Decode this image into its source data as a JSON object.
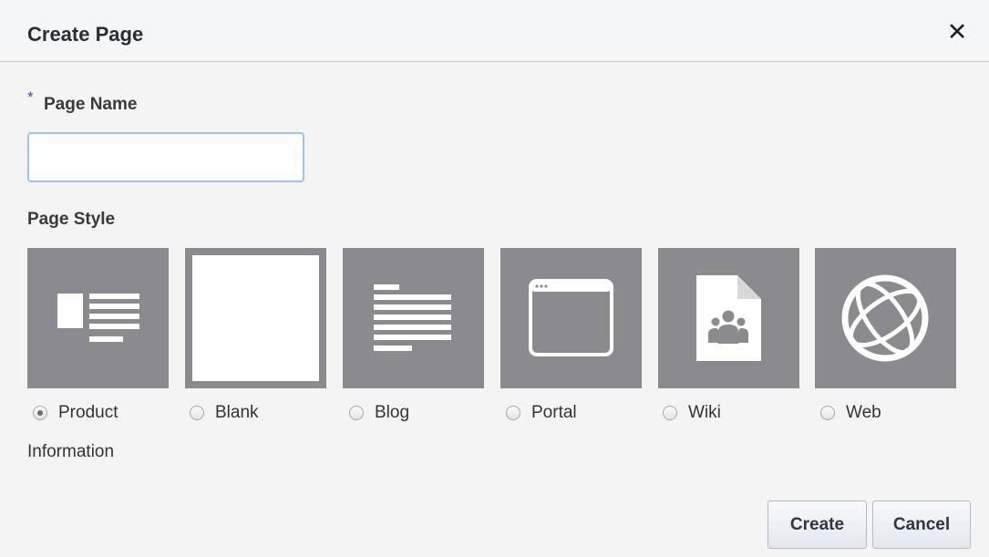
{
  "dialog": {
    "title": "Create Page",
    "close_icon": "close-icon"
  },
  "page_name": {
    "required_marker": "*",
    "label": "Page Name",
    "value": ""
  },
  "page_style": {
    "label": "Page Style",
    "options": [
      {
        "label": "Product",
        "label_continued": "Information",
        "icon": "product-information-icon",
        "selected": true
      },
      {
        "label": "Blank",
        "icon": "blank-page-icon",
        "selected": false
      },
      {
        "label": "Blog",
        "icon": "blog-icon",
        "selected": false
      },
      {
        "label": "Portal",
        "icon": "portal-window-icon",
        "selected": false
      },
      {
        "label": "Wiki",
        "icon": "wiki-document-icon",
        "selected": false
      },
      {
        "label": "Web",
        "icon": "web-globe-icon",
        "selected": false
      }
    ]
  },
  "buttons": {
    "create_label": "Create",
    "cancel_label": "Cancel"
  },
  "colors": {
    "tile_background": "#8a8a8f",
    "tile_foreground": "#ffffff",
    "input_border": "#9ec3ec",
    "required_marker": "#1f5fa8"
  }
}
